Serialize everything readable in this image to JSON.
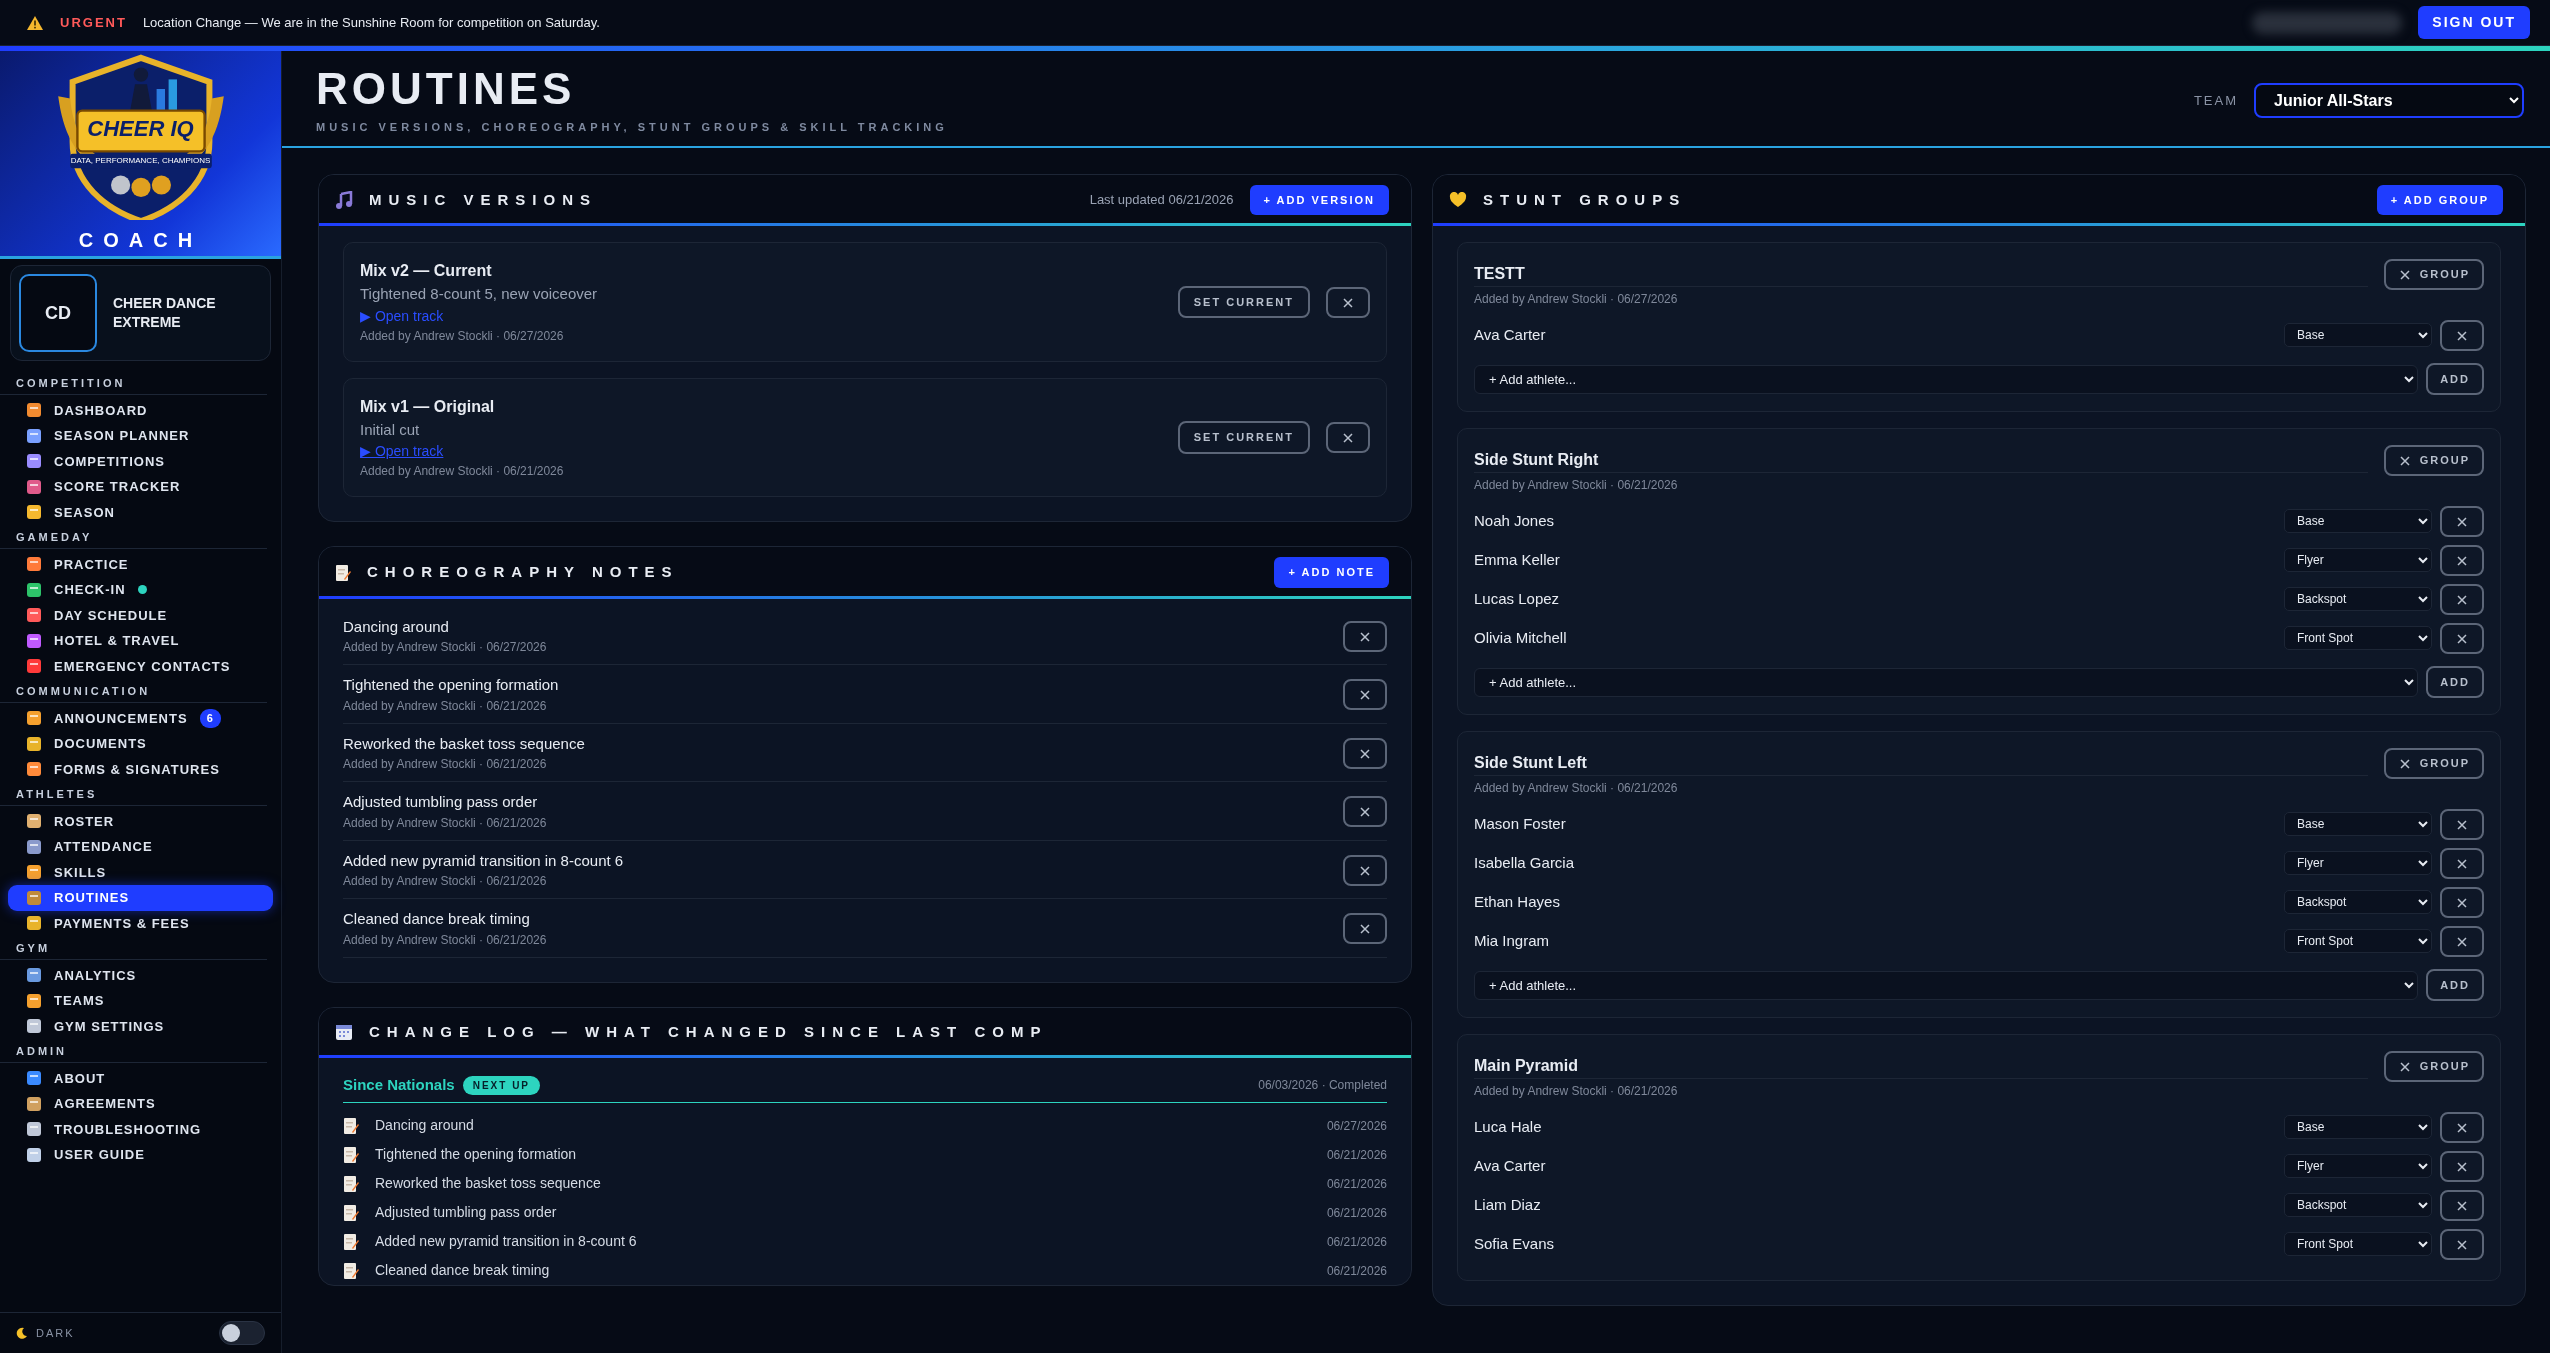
{
  "alert": {
    "label": "URGENT",
    "message": "Location Change — We are in the Sunshine Room for competition on Saturday."
  },
  "sign_out": "SIGN OUT",
  "brand": {
    "logo_text": "CHEER IQ",
    "logo_tagline": "DATA, PERFORMANCE, CHAMPIONS",
    "role": "COACH"
  },
  "gym": {
    "initials": "CD",
    "name": "CHEER DANCE EXTREME"
  },
  "nav": [
    {
      "heading": "COMPETITION",
      "items": [
        {
          "label": "DASHBOARD",
          "selected": false,
          "dot": false
        },
        {
          "label": "SEASON PLANNER",
          "selected": false,
          "dot": false
        },
        {
          "label": "COMPETITIONS",
          "selected": false,
          "dot": false
        },
        {
          "label": "SCORE TRACKER",
          "selected": false,
          "dot": false
        },
        {
          "label": "SEASON",
          "selected": false,
          "dot": false
        }
      ]
    },
    {
      "heading": "GAMEDAY",
      "items": [
        {
          "label": "PRACTICE",
          "selected": false,
          "dot": false
        },
        {
          "label": "CHECK-IN",
          "selected": false,
          "dot": true
        },
        {
          "label": "DAY SCHEDULE",
          "selected": false,
          "dot": false
        },
        {
          "label": "HOTEL & TRAVEL",
          "selected": false,
          "dot": false
        },
        {
          "label": "EMERGENCY CONTACTS",
          "selected": false,
          "dot": false
        }
      ]
    },
    {
      "heading": "COMMUNICATION",
      "items": [
        {
          "label": "ANNOUNCEMENTS",
          "selected": false,
          "dot": false,
          "badge": "6"
        },
        {
          "label": "DOCUMENTS",
          "selected": false,
          "dot": false
        },
        {
          "label": "FORMS & SIGNATURES",
          "selected": false,
          "dot": false
        }
      ]
    },
    {
      "heading": "ATHLETES",
      "items": [
        {
          "label": "ROSTER",
          "selected": false,
          "dot": false
        },
        {
          "label": "ATTENDANCE",
          "selected": false,
          "dot": false
        },
        {
          "label": "SKILLS",
          "selected": false,
          "dot": false
        },
        {
          "label": "ROUTINES",
          "selected": true,
          "dot": false
        },
        {
          "label": "PAYMENTS & FEES",
          "selected": false,
          "dot": false
        }
      ]
    },
    {
      "heading": "GYM",
      "items": [
        {
          "label": "ANALYTICS",
          "selected": false,
          "dot": false
        },
        {
          "label": "TEAMS",
          "selected": false,
          "dot": false
        },
        {
          "label": "GYM SETTINGS",
          "selected": false,
          "dot": false
        }
      ]
    },
    {
      "heading": "ADMIN",
      "items": [
        {
          "label": "ABOUT",
          "selected": false,
          "dot": false
        },
        {
          "label": "AGREEMENTS",
          "selected": false,
          "dot": false
        },
        {
          "label": "TROUBLESHOOTING",
          "selected": false,
          "dot": false
        },
        {
          "label": "USER GUIDE",
          "selected": false,
          "dot": false
        }
      ]
    }
  ],
  "theme_toggle": {
    "label": "DARK",
    "on": false
  },
  "page": {
    "title": "ROUTINES",
    "subtitle": "MUSIC VERSIONS, CHOREOGRAPHY, STUNT GROUPS & SKILL TRACKING",
    "team_label": "TEAM",
    "team": "Junior All-Stars"
  },
  "music": {
    "title": "MUSIC VERSIONS",
    "updated": "Last updated 06/21/2026",
    "add": "+ ADD VERSION",
    "versions": [
      {
        "name": "Mix v2 — Current",
        "description": "Tightened 8-count 5, new voiceover",
        "link": "▶ Open track",
        "underlined": false,
        "meta": "Added by Andrew Stockli · 06/27/2026",
        "set_current": "SET CURRENT"
      },
      {
        "name": "Mix v1 — Original",
        "description": "Initial cut",
        "link": "▶ Open track",
        "underlined": true,
        "meta": "Added by Andrew Stockli · 06/21/2026",
        "set_current": "SET CURRENT"
      }
    ]
  },
  "choreography": {
    "title": "CHOREOGRAPHY NOTES",
    "add": "+ ADD NOTE",
    "notes": [
      {
        "text": "Dancing around",
        "meta": "Added by Andrew Stockli · 06/27/2026"
      },
      {
        "text": "Tightened the opening formation",
        "meta": "Added by Andrew Stockli · 06/21/2026"
      },
      {
        "text": "Reworked the basket toss sequence",
        "meta": "Added by Andrew Stockli · 06/21/2026"
      },
      {
        "text": "Adjusted tumbling pass order",
        "meta": "Added by Andrew Stockli · 06/21/2026"
      },
      {
        "text": "Added new pyramid transition in 8-count 6",
        "meta": "Added by Andrew Stockli · 06/21/2026"
      },
      {
        "text": "Cleaned dance break timing",
        "meta": "Added by Andrew Stockli · 06/21/2026"
      }
    ]
  },
  "change_log": {
    "title": "CHANGE LOG — WHAT CHANGED SINCE LAST COMP",
    "since": "Since Nationals",
    "badge": "NEXT UP",
    "status": "06/03/2026 · Completed",
    "entries": [
      {
        "text": "Dancing around",
        "date": "06/27/2026"
      },
      {
        "text": "Tightened the opening formation",
        "date": "06/21/2026"
      },
      {
        "text": "Reworked the basket toss sequence",
        "date": "06/21/2026"
      },
      {
        "text": "Adjusted tumbling pass order",
        "date": "06/21/2026"
      },
      {
        "text": "Added new pyramid transition in 8-count 6",
        "date": "06/21/2026"
      },
      {
        "text": "Cleaned dance break timing",
        "date": "06/21/2026"
      }
    ]
  },
  "stunt_groups": {
    "title": "STUNT GROUPS",
    "add": "+ ADD GROUP",
    "groups": [
      {
        "name": "TESTT",
        "meta": "Added by Andrew Stockli · 06/27/2026",
        "remove_label": "GROUP",
        "athletes": [
          {
            "name": "Ava Carter",
            "role": "Base"
          }
        ],
        "add_athlete": "+ Add athlete...",
        "add_button": "ADD"
      },
      {
        "name": "Side Stunt Right",
        "meta": "Added by Andrew Stockli · 06/21/2026",
        "remove_label": "GROUP",
        "athletes": [
          {
            "name": "Noah Jones",
            "role": "Base"
          },
          {
            "name": "Emma Keller",
            "role": "Flyer"
          },
          {
            "name": "Lucas Lopez",
            "role": "Backspot"
          },
          {
            "name": "Olivia Mitchell",
            "role": "Front Spot"
          }
        ],
        "add_athlete": "+ Add athlete...",
        "add_button": "ADD"
      },
      {
        "name": "Side Stunt Left",
        "meta": "Added by Andrew Stockli · 06/21/2026",
        "remove_label": "GROUP",
        "athletes": [
          {
            "name": "Mason Foster",
            "role": "Base"
          },
          {
            "name": "Isabella Garcia",
            "role": "Flyer"
          },
          {
            "name": "Ethan Hayes",
            "role": "Backspot"
          },
          {
            "name": "Mia Ingram",
            "role": "Front Spot"
          }
        ],
        "add_athlete": "+ Add athlete...",
        "add_button": "ADD"
      },
      {
        "name": "Main Pyramid",
        "meta": "Added by Andrew Stockli · 06/21/2026",
        "remove_label": "GROUP",
        "athletes": [
          {
            "name": "Luca Hale",
            "role": "Base"
          },
          {
            "name": "Ava Carter",
            "role": "Flyer"
          },
          {
            "name": "Liam Diaz",
            "role": "Backspot"
          },
          {
            "name": "Sofia Evans",
            "role": "Front Spot"
          }
        ]
      }
    ]
  }
}
